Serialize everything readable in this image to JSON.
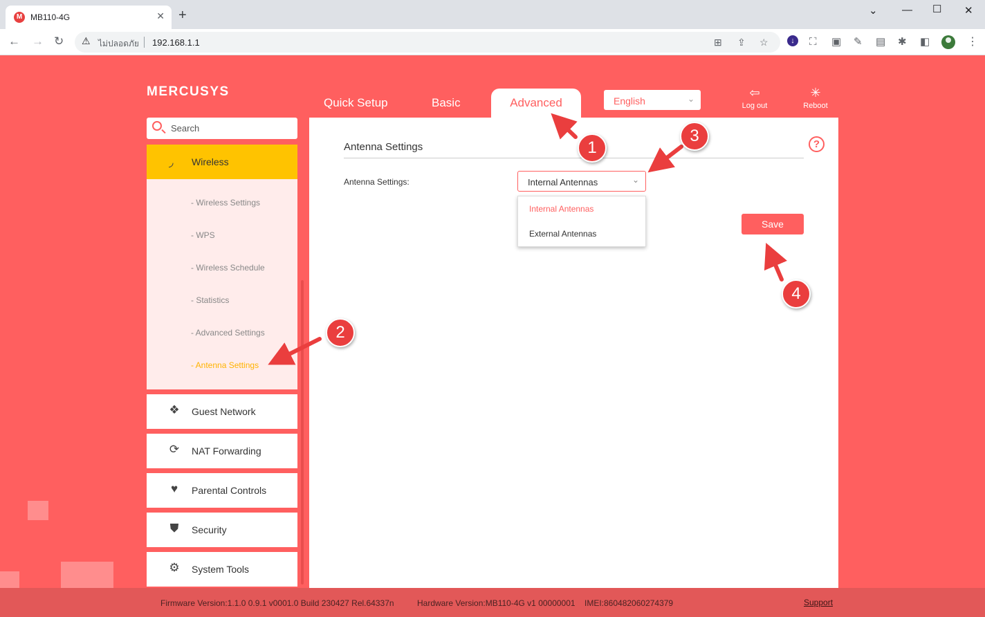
{
  "browser": {
    "tab_title": "MB110-4G",
    "tab_favicon_letter": "M",
    "security_label": "ไม่ปลอดภัย",
    "url": "192.168.1.1"
  },
  "header": {
    "logo": "MERCUSYS",
    "tabs": [
      "Quick Setup",
      "Basic",
      "Advanced"
    ],
    "active_tab": "Advanced",
    "language": "English",
    "logout_label": "Log out",
    "reboot_label": "Reboot"
  },
  "sidebar": {
    "search_placeholder": "Search",
    "active_section": "Wireless",
    "sub_items": [
      "- Wireless Settings",
      "- WPS",
      "- Wireless Schedule",
      "- Statistics",
      "- Advanced Settings",
      "- Antenna Settings"
    ],
    "active_sub_item": "- Antenna Settings",
    "items": [
      {
        "label": "Guest Network",
        "icon": "guest-network-icon"
      },
      {
        "label": "NAT Forwarding",
        "icon": "nat-forwarding-icon"
      },
      {
        "label": "Parental Controls",
        "icon": "heart-icon"
      },
      {
        "label": "Security",
        "icon": "shield-icon"
      },
      {
        "label": "System Tools",
        "icon": "gear-icon"
      }
    ]
  },
  "main": {
    "section_title": "Antenna Settings",
    "field_label": "Antenna Settings:",
    "select_value": "Internal Antennas",
    "options": [
      "Internal Antennas",
      "External Antennas"
    ],
    "save_label": "Save"
  },
  "footer": {
    "firmware": "Firmware Version:1.1.0 0.9.1 v0001.0 Build 230427 Rel.64337n",
    "hardware": "Hardware Version:MB110-4G v1 00000001",
    "imei": "IMEI:860482060274379",
    "support": "Support"
  },
  "annotations": [
    "1",
    "2",
    "3",
    "4"
  ],
  "colors": {
    "brand": "#ff5f5f",
    "active_section": "#ffc300",
    "active_sub_item": "#ffb300",
    "annotation": "#ea3e3e"
  }
}
